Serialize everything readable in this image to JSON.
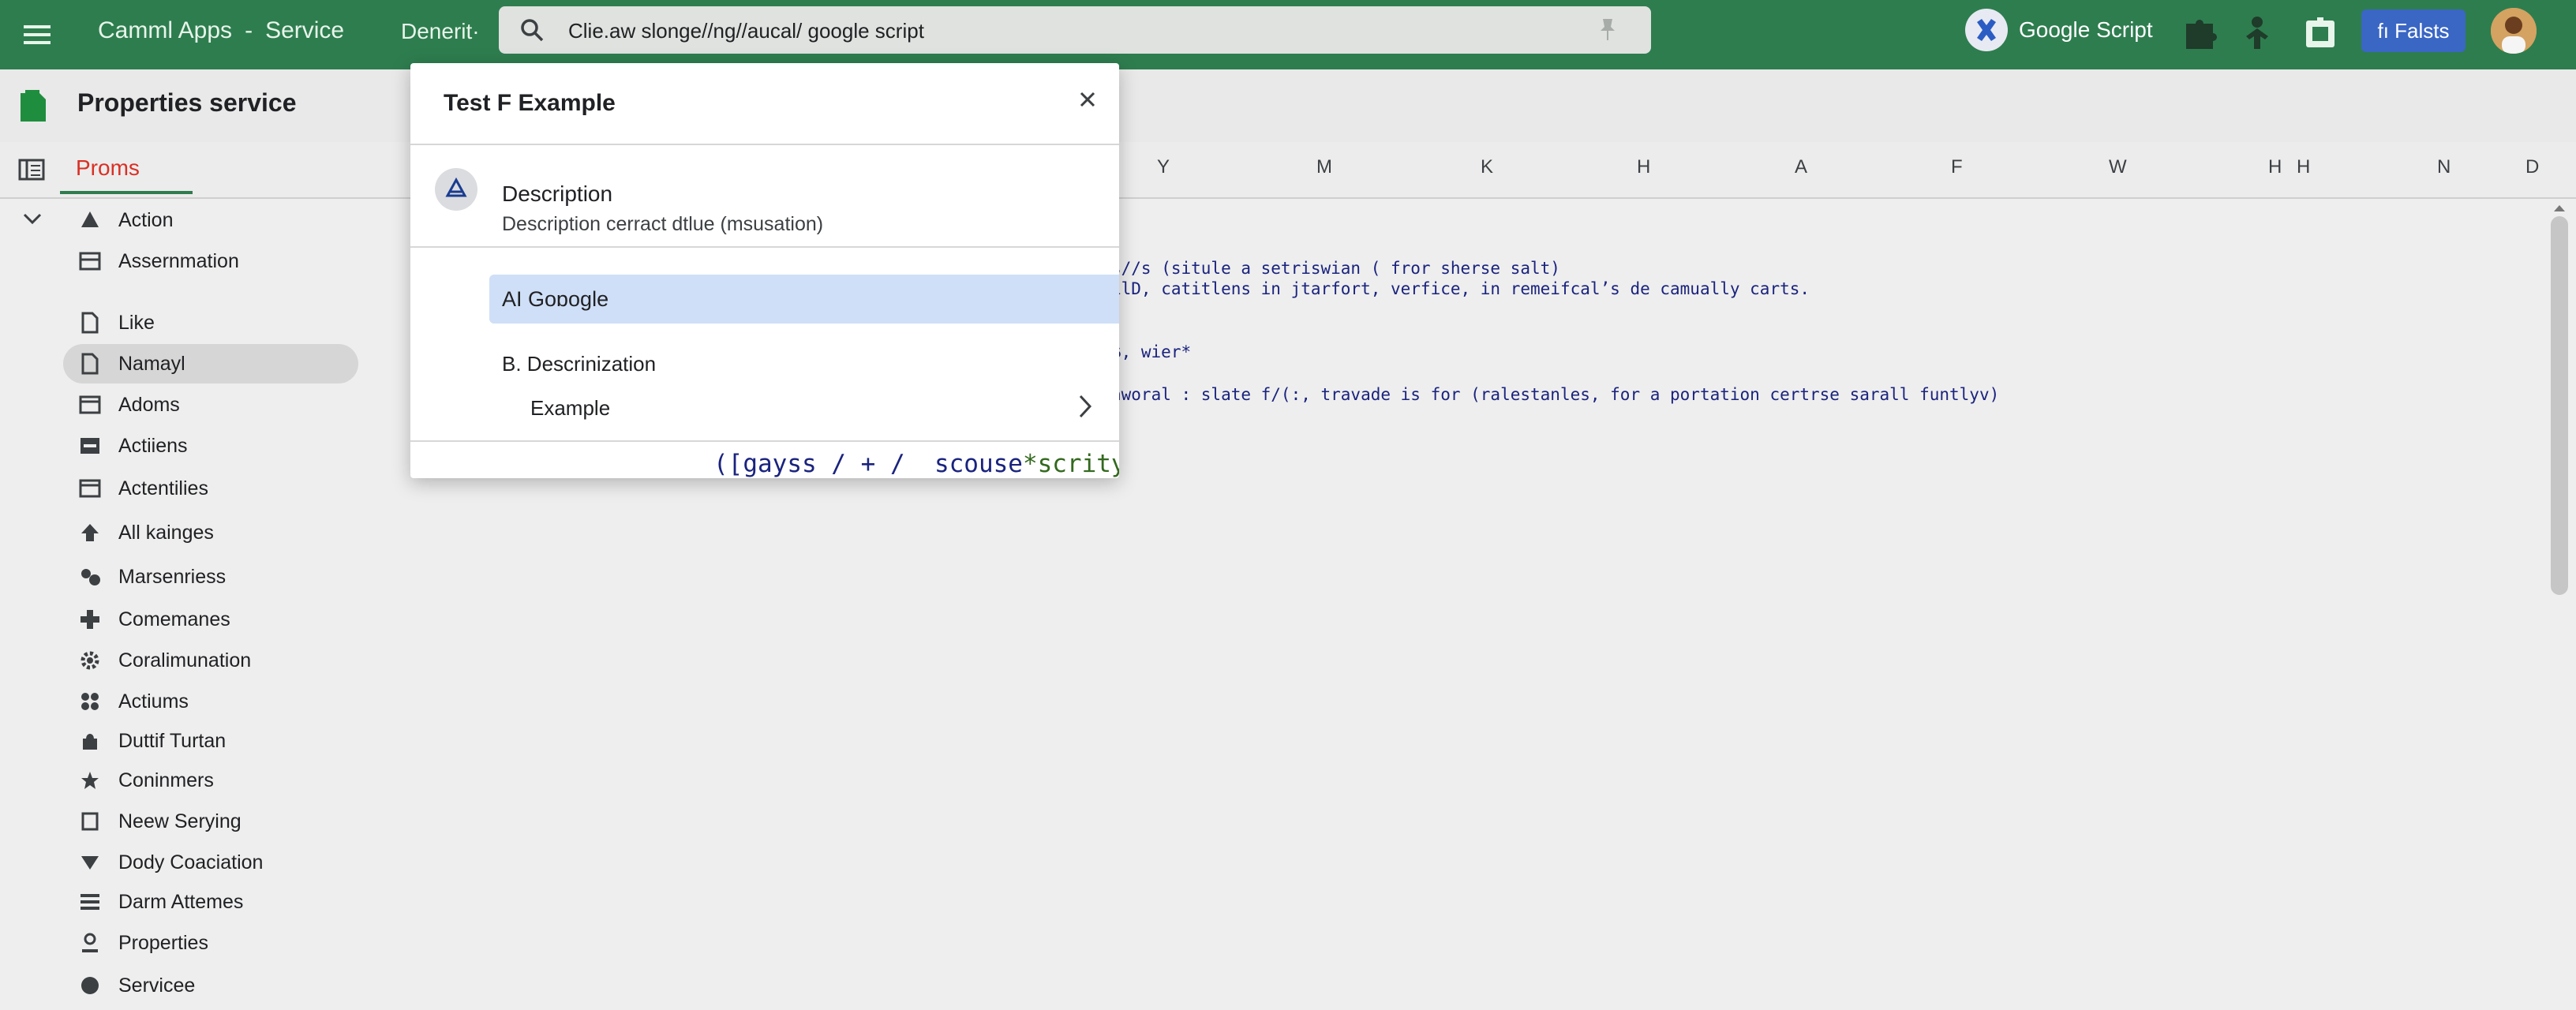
{
  "topbar": {
    "app_name": "Camml Apps",
    "separator": "-",
    "section": "Service",
    "crumb": "Denerit·",
    "search_value": "Clie.aw slonge//ng//aucal/ google script",
    "product": "Google Script",
    "action_button": "fı Falsts"
  },
  "page": {
    "title": "Properties service",
    "tab": "Proms"
  },
  "columns": [
    "Y",
    "M",
    "K",
    "H",
    "A",
    "F",
    "W",
    "H",
    "H",
    "N",
    "D"
  ],
  "sidebar": {
    "items": [
      {
        "label": "Action",
        "icon": "action-icon"
      },
      {
        "label": "Assernmation",
        "icon": "panel-icon"
      },
      {
        "label": "Like",
        "icon": "file-icon"
      },
      {
        "label": "Namayl",
        "icon": "file-icon",
        "selected": true
      },
      {
        "label": "Adoms",
        "icon": "window-icon"
      },
      {
        "label": "Actiiens",
        "icon": "panel-icon"
      },
      {
        "label": "Actentilies",
        "icon": "window-icon"
      },
      {
        "label": "All kainges",
        "icon": "arrow-up-icon"
      },
      {
        "label": "Marsenriess",
        "icon": "gear-cluster-icon"
      },
      {
        "label": "Comemanes",
        "icon": "puzzle-icon"
      },
      {
        "label": "Coralimunation",
        "icon": "gear-icon"
      },
      {
        "label": "Actiums",
        "icon": "grid-dots-icon"
      },
      {
        "label": "Duttif Turtan",
        "icon": "bag-icon"
      },
      {
        "label": "Coninmers",
        "icon": "star-icon"
      },
      {
        "label": "Neew Serying",
        "icon": "square-icon"
      },
      {
        "label": "Dody Coaciation",
        "icon": "triangle-down-icon"
      },
      {
        "label": "Darm Attemes",
        "icon": "list-icon"
      },
      {
        "label": "Properties",
        "icon": "person-pin-icon"
      },
      {
        "label": "Servicee",
        "icon": "circle-icon"
      }
    ]
  },
  "code_lines": [
    "s//s (situle a setriswian ( fror sherse salt)",
    "ılD, catitlens in jtarfort, verfice, in remeifcal’s de camually carts.",
    "ẞ, wier*",
    "aworal : slate f/(:, travade is for (ralestanles, for a portation certrse sarall funtlyv)"
  ],
  "dialog": {
    "title": "Test F Example",
    "desc_label": "Description",
    "desc_sub": "Description cerract dtlue (msusation)",
    "option_selected": "AI  Goɒogle",
    "option_b": "B.  Descrinization",
    "option_example": "Example",
    "code_part1": "([gayss / + /  scouse",
    "code_part2": "*scrity",
    "code_part3": " ʼ"
  }
}
